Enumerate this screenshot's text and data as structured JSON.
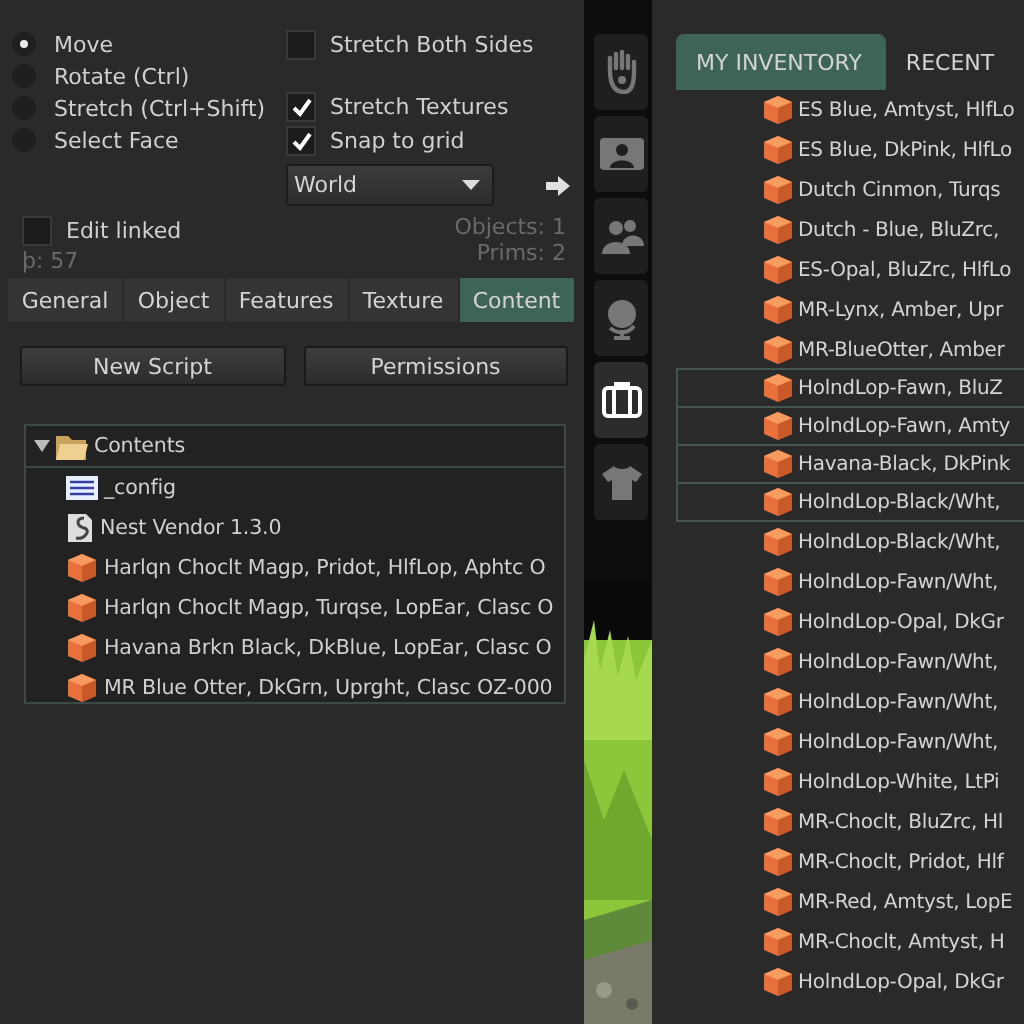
{
  "tool_modes": [
    {
      "label": "Move",
      "selected": true
    },
    {
      "label": "Rotate (Ctrl)",
      "selected": false
    },
    {
      "label": "Stretch (Ctrl+Shift)",
      "selected": false
    },
    {
      "label": "Select Face",
      "selected": false
    }
  ],
  "options": [
    {
      "label": "Stretch Both Sides",
      "checked": false
    },
    {
      "label": "Stretch Textures",
      "checked": true
    },
    {
      "label": "Snap to grid",
      "checked": true
    }
  ],
  "grid_dropdown": {
    "value": "World"
  },
  "edit_linked": {
    "label": "Edit linked",
    "checked": false
  },
  "code_note": "þ: 57",
  "objects_count": "Objects: 1",
  "prims_count": "Prims: 2",
  "tabs": [
    {
      "label": "General",
      "selected": false
    },
    {
      "label": "Object",
      "selected": false
    },
    {
      "label": "Features",
      "selected": false
    },
    {
      "label": "Texture",
      "selected": false
    },
    {
      "label": "Content",
      "selected": true
    }
  ],
  "buttons": [
    "New Script",
    "Permissions"
  ],
  "contents": {
    "label": "Contents",
    "expanded": true,
    "children": [
      {
        "kind": "notecard",
        "label": "_config"
      },
      {
        "kind": "script",
        "label": "Nest Vendor 1.3.0"
      },
      {
        "kind": "object",
        "label": "Harlqn Choclt Magp, Pridot, HlfLop, Aphtc O"
      },
      {
        "kind": "object",
        "label": "Harlqn Choclt Magp, Turqse, LopEar, Clasc O"
      },
      {
        "kind": "object",
        "label": "Havana Brkn Black, DkBlue, LopEar, Clasc O"
      },
      {
        "kind": "object",
        "label": "MR Blue Otter, DkGrn, Uprght, Clasc OZ-000"
      }
    ]
  },
  "sidebar": [
    {
      "kind": "hand",
      "selected": false
    },
    {
      "kind": "profile",
      "selected": false
    },
    {
      "kind": "people",
      "selected": false
    },
    {
      "kind": "globe",
      "selected": false
    },
    {
      "kind": "inventory",
      "selected": true
    },
    {
      "kind": "shirt",
      "selected": false
    }
  ],
  "inventory_tabs": [
    {
      "label": "MY INVENTORY",
      "selected": true
    },
    {
      "label": "RECENT",
      "selected": false
    }
  ],
  "inventory_items": [
    {
      "label": "ES Blue, Amtyst, HlfLo",
      "selected": false
    },
    {
      "label": "ES Blue, DkPink, HlfLo",
      "selected": false
    },
    {
      "label": "Dutch Cinmon, Turqs",
      "selected": false
    },
    {
      "label": "Dutch - Blue, BluZrc,",
      "selected": false
    },
    {
      "label": "ES-Opal, BluZrc, HlfLo",
      "selected": false
    },
    {
      "label": "MR-Lynx, Amber, Upr",
      "selected": false
    },
    {
      "label": "MR-BlueOtter, Amber",
      "selected": false
    },
    {
      "label": "HolndLop-Fawn, BluZ",
      "selected": true
    },
    {
      "label": "HolndLop-Fawn, Amty",
      "selected": true
    },
    {
      "label": "Havana-Black, DkPink",
      "selected": true
    },
    {
      "label": "HolndLop-Black/Wht,",
      "selected": true
    },
    {
      "label": "HolndLop-Black/Wht,",
      "selected": false
    },
    {
      "label": "HolndLop-Fawn/Wht,",
      "selected": false
    },
    {
      "label": "HolndLop-Opal, DkGr",
      "selected": false
    },
    {
      "label": "HolndLop-Fawn/Wht,",
      "selected": false
    },
    {
      "label": "HolndLop-Fawn/Wht,",
      "selected": false
    },
    {
      "label": "HolndLop-Fawn/Wht,",
      "selected": false
    },
    {
      "label": "HolndLop-White, LtPi",
      "selected": false
    },
    {
      "label": "MR-Choclt, BluZrc, Hl",
      "selected": false
    },
    {
      "label": "MR-Choclt, Pridot, Hlf",
      "selected": false
    },
    {
      "label": "MR-Red, Amtyst, LopE",
      "selected": false
    },
    {
      "label": "MR-Choclt, Amtyst, H",
      "selected": false
    },
    {
      "label": "HolndLop-Opal, DkGr",
      "selected": false
    }
  ]
}
